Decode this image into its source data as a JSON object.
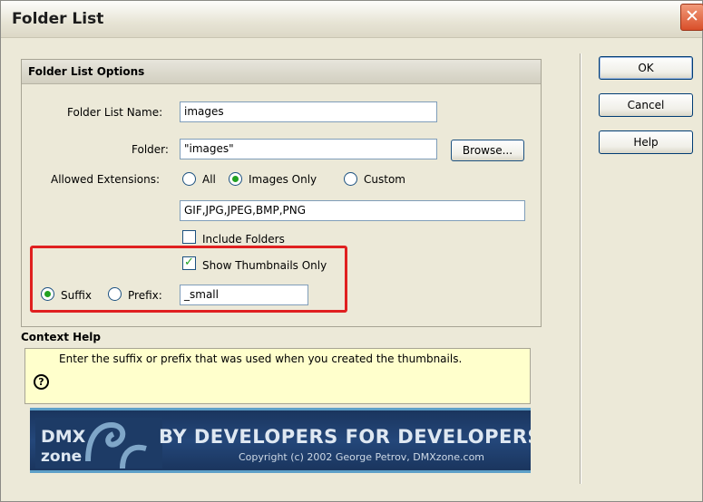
{
  "window": {
    "title": "Folder List",
    "close_glyph": "✕"
  },
  "buttons": {
    "ok": "OK",
    "cancel": "Cancel",
    "help": "Help",
    "browse": "Browse..."
  },
  "options": {
    "group_title": "Folder List Options",
    "folder_list_name_label": "Folder List Name:",
    "folder_list_name_value": "images",
    "folder_label": "Folder:",
    "folder_value": "\"images\"",
    "allowed_extensions_label": "Allowed Extensions:",
    "ext_all_label": "All",
    "ext_images_only_label": "Images Only",
    "ext_custom_label": "Custom",
    "ext_selected": "Images Only",
    "extensions_value": "GIF,JPG,JPEG,BMP,PNG",
    "include_folders_label": "Include Folders",
    "include_folders_checked": false,
    "show_thumbnails_label": "Show Thumbnails Only",
    "show_thumbnails_checked": true,
    "suffix_label": "Suffix",
    "prefix_label": "Prefix:",
    "affix_selected": "Suffix",
    "affix_value": "_small"
  },
  "context_help": {
    "title": "Context Help",
    "icon_glyph": "?",
    "text": "Enter the suffix or prefix that was used when you created the thumbnails."
  },
  "banner": {
    "logo_top": "DMX",
    "logo_bottom": "zone",
    "tagline": "BY DEVELOPERS FOR DEVELOPERS",
    "copyright": "Copyright (c) 2002 George Petrov, DMXzone.com"
  },
  "colors": {
    "highlight_box": "#e02020",
    "context_help_bg": "#ffffcc",
    "banner_bg": "#24477a"
  }
}
